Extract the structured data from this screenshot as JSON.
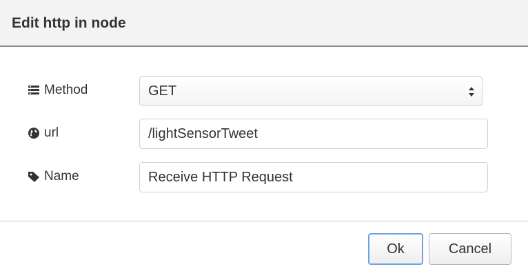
{
  "dialog": {
    "title": "Edit http in node"
  },
  "form": {
    "method": {
      "label": "Method",
      "icon": "list-icon",
      "value": "GET"
    },
    "url": {
      "label": "url",
      "icon": "globe-icon",
      "value": "/lightSensorTweet"
    },
    "name": {
      "label": "Name",
      "icon": "tag-icon",
      "value": "Receive HTTP Request"
    }
  },
  "buttons": {
    "ok_label": "Ok",
    "cancel_label": "Cancel"
  },
  "colors": {
    "primary_border": "#6ea2dc",
    "header_bg": "#f3f3f3"
  }
}
